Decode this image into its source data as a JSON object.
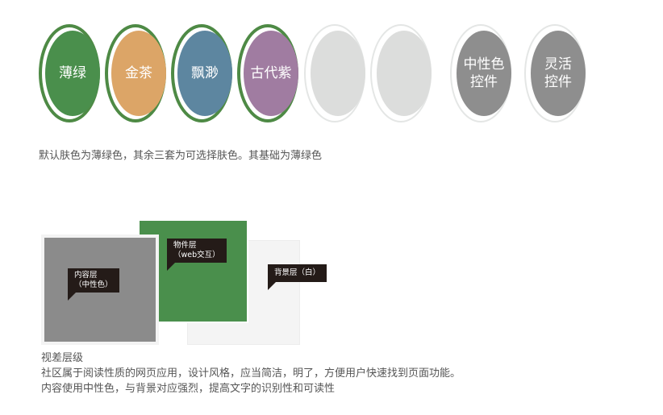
{
  "swatches": [
    {
      "label": "薄绿",
      "color": "#4a8f4c"
    },
    {
      "label": "金茶",
      "color": "#dca567"
    },
    {
      "label": "飘渺",
      "color": "#5d86a0"
    },
    {
      "label": "古代紫",
      "color": "#a07ca1"
    },
    {
      "label": "",
      "color": "#dcdddc"
    },
    {
      "label": "",
      "color": "#dcdddc"
    },
    {
      "label": "中性色\n控件",
      "color": "#8e8e8e"
    },
    {
      "label": "灵活\n控件",
      "color": "#8e8e8e"
    }
  ],
  "description": "默认肤色为薄绿色，其余三套为可选择肤色。其基础为薄绿色",
  "layers": {
    "content_tag": "内容层\n（中性色）",
    "object_tag": "物件层\n（web交互）",
    "background_tag": "背景层（白）"
  },
  "bottom": {
    "title": "视差层级",
    "line1": "社区属于阅读性质的网页应用，设计风格，应当简洁，明了，方便用户快速找到页面功能。",
    "line2": "内容使用中性色，与背景对应强烈，提高文字的识别性和可读性"
  },
  "colors": {
    "green": "#4a8f4c",
    "gray": "#8b8b8b",
    "background_panel": "#f4f4f4",
    "tag_bg": "#241b18"
  }
}
